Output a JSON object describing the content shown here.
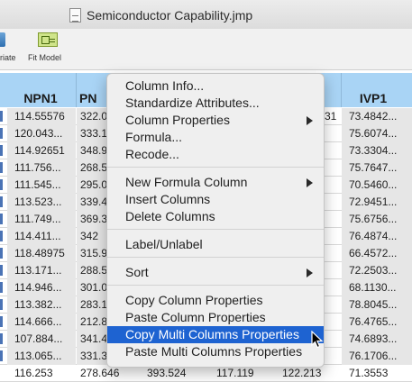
{
  "window": {
    "title": "Semiconductor Capability.jmp"
  },
  "toolbar": {
    "left_label": "riate",
    "fit_model_label": "Fit Model"
  },
  "table": {
    "headers": {
      "npn1": "NPN1",
      "pn_partial": "PN",
      "ivp1": "IVP1"
    },
    "rows": [
      {
        "npn1": "114.55576",
        "pn": "322.0",
        "ivp1": "73.4842..."
      },
      {
        "npn1": "120.043...",
        "pn": "333.1",
        "ivp1": "75.6074..."
      },
      {
        "npn1": "114.92651",
        "pn": "348.9",
        "ivp1": "73.3304..."
      },
      {
        "npn1": "111.756...",
        "pn": "268.5",
        "ivp1": "75.7647..."
      },
      {
        "npn1": "111.545...",
        "pn": "295.0",
        "ivp1": "70.5460..."
      },
      {
        "npn1": "113.523...",
        "pn": "339.4",
        "ivp1": "72.9451..."
      },
      {
        "npn1": "111.749...",
        "pn": "369.3",
        "ivp1": "75.6756..."
      },
      {
        "npn1": "114.411...",
        "pn": "342",
        "ivp1": "76.4874..."
      },
      {
        "npn1": "118.48975",
        "pn": "315.9",
        "ivp1": "66.4572..."
      },
      {
        "npn1": "113.171...",
        "pn": "288.5",
        "ivp1": "72.2503..."
      },
      {
        "npn1": "114.946...",
        "pn": "301.0",
        "ivp1": "68.1130..."
      },
      {
        "npn1": "113.382...",
        "pn": "283.1",
        "ivp1": "78.8045..."
      },
      {
        "npn1": "114.666...",
        "pn": "212.8",
        "ivp1": "76.4765..."
      },
      {
        "npn1": "107.884...",
        "pn": "341.4",
        "ivp1": "74.6893..."
      },
      {
        "npn1": "113.065...",
        "pn": "331.3",
        "ivp1": "76.1706..."
      }
    ],
    "partial_cell_row0": "31",
    "last_row": [
      "116.253",
      "278.646",
      "393.524",
      "117.119",
      "122.213",
      "71.3553"
    ]
  },
  "context_menu": {
    "items": {
      "column_info": "Column Info...",
      "standardize_attributes": "Standardize Attributes...",
      "column_properties": "Column Properties",
      "formula": "Formula...",
      "recode": "Recode...",
      "new_formula_column": "New Formula Column",
      "insert_columns": "Insert Columns",
      "delete_columns": "Delete Columns",
      "label_unlabel": "Label/Unlabel",
      "sort": "Sort",
      "copy_column_properties": "Copy Column Properties",
      "paste_column_properties": "Paste Column Properties",
      "copy_multi_columns_properties": "Copy Multi Columns Properties",
      "paste_multi_columns_properties": "Paste Multi Columns Properties"
    },
    "highlighted_item": "copy_multi_columns_properties"
  },
  "colors": {
    "header_bg": "#a9d4f5",
    "menu_highlight": "#1e63d1",
    "menu_bg": "#efefef"
  }
}
